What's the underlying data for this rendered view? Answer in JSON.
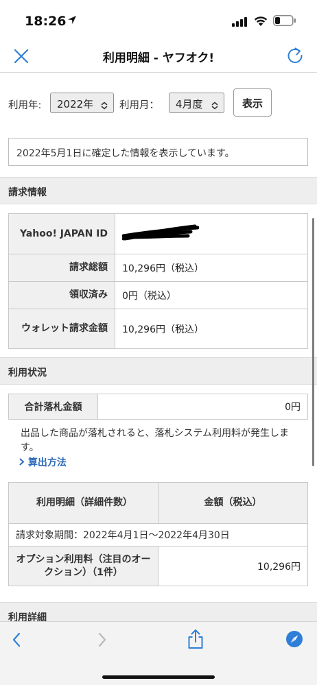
{
  "status_bar": {
    "time": "18:26"
  },
  "nav": {
    "title": "利用明細 - ヤフオク!"
  },
  "filter": {
    "year_label": "利用年:",
    "year_value": "2022年",
    "month_label": "利用月：",
    "month_value": "4月度",
    "show_button": "表示"
  },
  "info_message": "2022年5月1日に確定した情報を表示しています。",
  "billing": {
    "section_title": "請求情報",
    "rows": [
      {
        "label": "Yahoo! JAPAN ID",
        "value": ""
      },
      {
        "label": "請求総額",
        "value": "10,296円（税込）"
      },
      {
        "label": "領収済み",
        "value": "0円（税込）"
      },
      {
        "label": "ウォレット請求金額",
        "value": "10,296円（税込）"
      }
    ]
  },
  "usage": {
    "section_title": "利用状況",
    "summary_label": "合計落札金額",
    "summary_value": "0円",
    "note": "出品した商品が落札されると、落札システム利用料が発生します。",
    "link": "算出方法"
  },
  "detail_table": {
    "header_item": "利用明細（詳細件数）",
    "header_amount": "金額（税込）",
    "period": "請求対象期間：2022年4月1日〜2022年4月30日",
    "rows": [
      {
        "item": "オプション利用料（注目のオークション）（1件）",
        "amount": "10,296円"
      }
    ]
  },
  "next_section_title": "利用詳細",
  "icons": {
    "close": "close-icon",
    "refresh": "refresh-icon",
    "back": "chevron-left-icon",
    "forward": "chevron-right-icon",
    "share": "share-icon",
    "safari": "compass-icon"
  },
  "colors": {
    "accent": "#2f7fd8",
    "link": "#2e6bb8",
    "header_bg": "#eeeeee"
  }
}
